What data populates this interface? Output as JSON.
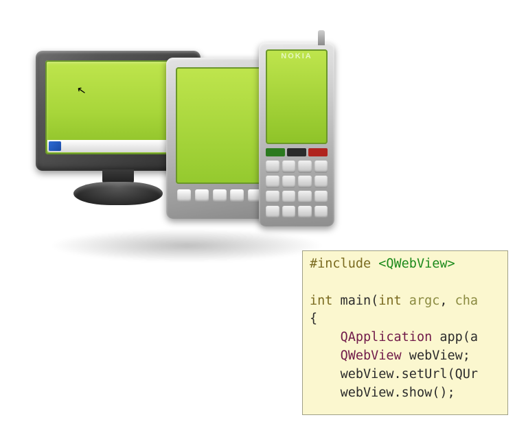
{
  "devices": {
    "phone_brand": "NOKIA",
    "cursor_glyph": "↖",
    "monitor_start_icon": "start-icon"
  },
  "code": {
    "line1_directive": "#include",
    "line1_header": "<QWebView>",
    "line3_kw": "int",
    "line3_main": " main(",
    "line3_kw2": "int",
    "line3_arg1": " argc",
    "line3_sep": ", ",
    "line3_arg2": "cha",
    "line4": "{",
    "line5_indent": "    ",
    "line5_type": "QApplication",
    "line5_rest": " app(a",
    "line6_type": "QWebView",
    "line6_rest": " webView;",
    "line7": "webView.setUrl(QUr",
    "line8": "webView.show();"
  }
}
